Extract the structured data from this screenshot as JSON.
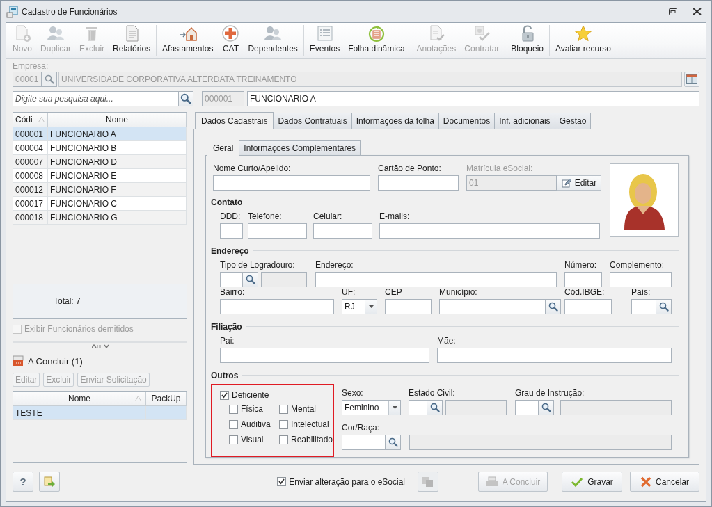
{
  "window": {
    "title": "Cadastro de Funcionários"
  },
  "toolbar": [
    [
      {
        "label": "Novo",
        "kind": "new",
        "disabled": true
      },
      {
        "label": "Duplicar",
        "kind": "duplicate",
        "disabled": true
      },
      {
        "label": "Excluir",
        "kind": "delete",
        "disabled": true
      },
      {
        "label": "Relatórios",
        "kind": "reports",
        "disabled": false
      }
    ],
    [
      {
        "label": "Afastamentos",
        "kind": "leave",
        "disabled": false
      },
      {
        "label": "CAT",
        "kind": "cat",
        "disabled": false
      },
      {
        "label": "Dependentes",
        "kind": "people",
        "disabled": false
      }
    ],
    [
      {
        "label": "Eventos",
        "kind": "list",
        "disabled": false
      },
      {
        "label": "Folha dinâmica",
        "kind": "payroll",
        "disabled": false
      }
    ],
    [
      {
        "label": "Anotações",
        "kind": "notes",
        "disabled": true
      },
      {
        "label": "Contratar",
        "kind": "hire",
        "disabled": true
      }
    ],
    [
      {
        "label": "Bloqueio",
        "kind": "lock",
        "disabled": false
      }
    ],
    [
      {
        "label": "Avaliar recurso",
        "kind": "star",
        "disabled": false
      }
    ]
  ],
  "company": {
    "label": "Empresa:",
    "code": "00001",
    "name": "UNIVERSIDADE CORPORATIVA ALTERDATA TREINAMENTO"
  },
  "search": {
    "placeholder": "Digite sua pesquisa aqui..."
  },
  "employee": {
    "code": "000001",
    "name": "FUNCIONARIO A"
  },
  "employees": {
    "columns": [
      "Códi",
      "Nome"
    ],
    "rows": [
      {
        "code": "000001",
        "name": "FUNCIONARIO A",
        "selected": true
      },
      {
        "code": "000004",
        "name": "FUNCIONARIO B",
        "selected": false
      },
      {
        "code": "000007",
        "name": "FUNCIONARIO D",
        "selected": false
      },
      {
        "code": "000008",
        "name": "FUNCIONARIO E",
        "selected": false
      },
      {
        "code": "000012",
        "name": "FUNCIONARIO F",
        "selected": false
      },
      {
        "code": "000017",
        "name": "FUNCIONARIO C",
        "selected": false
      },
      {
        "code": "000018",
        "name": "FUNCIONARIO G",
        "selected": false
      }
    ],
    "total": "Total: 7"
  },
  "show_dismissed": {
    "label": "Exibir Funcionários demitidos",
    "checked": false
  },
  "pending": {
    "title": "A Concluir (1)",
    "buttons": [
      "Editar",
      "Excluir",
      "Enviar Solicitação"
    ],
    "columns": [
      "Nome",
      "PackUp"
    ],
    "rows": [
      {
        "name": "TESTE",
        "selected": true
      }
    ]
  },
  "tabs": [
    {
      "label": "Dados Cadastrais",
      "selected": true
    },
    {
      "label": "Dados Contratuais",
      "selected": false
    },
    {
      "label": "Informações da folha",
      "selected": false
    },
    {
      "label": "Documentos",
      "selected": false
    },
    {
      "label": "Inf. adicionais",
      "selected": false
    },
    {
      "label": "Gestão",
      "selected": false
    }
  ],
  "subtabs": [
    {
      "label": "Geral",
      "selected": true
    },
    {
      "label": "Informações Complementares",
      "selected": false
    }
  ],
  "form": {
    "row1": [
      {
        "label": "Nome Curto/Apelido:",
        "kind": "text"
      },
      {
        "label": "Cartão de Ponto:",
        "kind": "text"
      },
      {
        "label": "Matrícula eSocial:",
        "kind": "locked",
        "value": "01",
        "button": "Editar"
      }
    ],
    "sections": [
      {
        "title": "Contato",
        "lines": [
          {
            "fields": [
              {
                "label": "DDD:",
                "kind": "text"
              },
              {
                "label": "Telefone:",
                "kind": "text"
              },
              {
                "label": "Celular:",
                "kind": "text"
              },
              {
                "label": "E-mails:",
                "kind": "text"
              }
            ]
          }
        ]
      },
      {
        "title": "Endereço",
        "lines": [
          {
            "fields": [
              {
                "label": "Tipo de Logradouro:",
                "kind": "lookupdesc"
              },
              {
                "label": "Endereço:",
                "kind": "text"
              },
              {
                "label": "Número:",
                "kind": "text"
              },
              {
                "label": "Complemento:",
                "kind": "text"
              }
            ]
          },
          {
            "fields": [
              {
                "label": "Bairro:",
                "kind": "text"
              },
              {
                "label": "UF:",
                "kind": "select",
                "value": "RJ"
              },
              {
                "label": "CEP",
                "kind": "text"
              },
              {
                "label": "Município:",
                "kind": "lookup"
              },
              {
                "label": "Cód.IBGE:",
                "kind": "text"
              },
              {
                "label": "País:",
                "kind": "lookup"
              }
            ]
          }
        ]
      },
      {
        "title": "Filiação",
        "lines": [
          {
            "fields": [
              {
                "label": "Pai:",
                "kind": "text"
              },
              {
                "label": "Mãe:",
                "kind": "text"
              }
            ]
          }
        ]
      }
    ],
    "others": {
      "title": "Outros",
      "deficient": {
        "label": "Deficiente",
        "checked": true
      },
      "types": [
        {
          "label": "Física",
          "checked": false
        },
        {
          "label": "Mental",
          "checked": false
        },
        {
          "label": "Auditiva",
          "checked": false
        },
        {
          "label": "Intelectual",
          "checked": false
        },
        {
          "label": "Visual",
          "checked": false
        },
        {
          "label": "Reabilitado",
          "checked": false
        }
      ],
      "lines": [
        {
          "fields": [
            {
              "label": "Sexo:",
              "kind": "select",
              "value": "Feminino"
            },
            {
              "label": "Estado Civil:",
              "kind": "lookupdesc"
            },
            {
              "label": "Grau de Instrução:",
              "kind": "lookupdesc"
            }
          ]
        },
        {
          "fields": [
            {
              "label": "Cor/Raça:",
              "kind": "lookupdesc"
            }
          ]
        }
      ]
    }
  },
  "footer": {
    "help": "?",
    "esocial": {
      "label": "Enviar alteração para o eSocial",
      "checked": true
    },
    "buttons": [
      {
        "label": "A Concluir",
        "kind": "pending",
        "disabled": true
      },
      {
        "label": "Gravar",
        "kind": "save",
        "disabled": false
      },
      {
        "label": "Cancelar",
        "kind": "cancel",
        "disabled": false
      }
    ]
  }
}
